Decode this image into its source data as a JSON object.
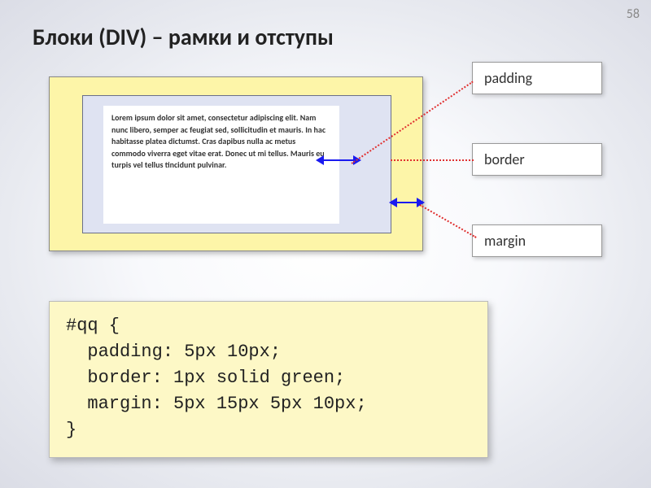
{
  "page_number": "58",
  "title": "Блоки (DIV) – рамки и отступы",
  "lorem_text": "Lorem ipsum dolor sit amet, consectetur adipiscing elit. Nam nunc libero, semper ac feugiat sed, sollicitudin et mauris. In hac habitasse platea dictumst. Cras dapibus nulla ac metus commodo viverra eget vitae erat. Donec ut mi tellus. Mauris eu turpis vel tellus tincidunt pulvinar.",
  "labels": {
    "padding": "padding",
    "border": "border",
    "margin": "margin"
  },
  "code": "#qq {\n  padding: 5px 10px;\n  border: 1px solid green;\n  margin: 5px 15px 5px 10px;\n}"
}
